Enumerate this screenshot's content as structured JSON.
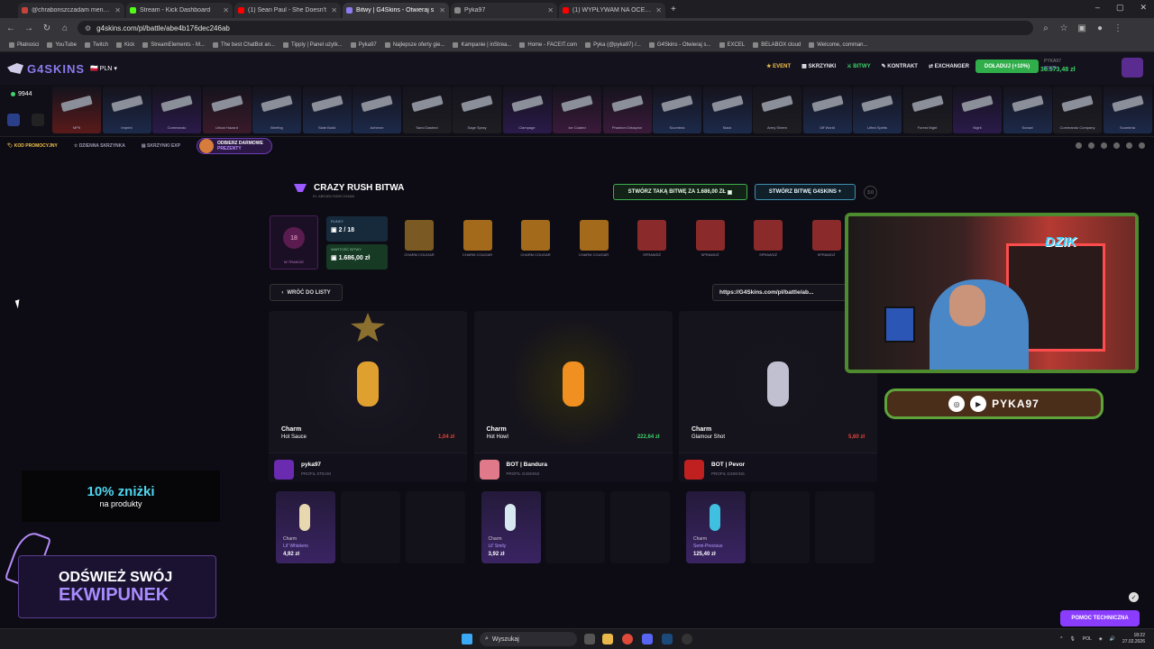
{
  "browser": {
    "tabs": [
      {
        "title": "@chrabonszczadam mention",
        "color": "#c7433a",
        "active": false
      },
      {
        "title": "Stream - Kick Dashboard",
        "color": "#53fc18",
        "active": false
      },
      {
        "title": "(1) Sean Paul - She Doesn't",
        "color": "#ff0000",
        "active": false
      },
      {
        "title": "Bitwy | G4Skins - Otwieraj s",
        "color": "#8b7cf0",
        "active": true
      },
      {
        "title": "Pyka97",
        "color": "#888888",
        "active": false
      },
      {
        "title": "(1) WYPŁYWAM NA OCEAN...",
        "color": "#ff0000",
        "active": false
      }
    ],
    "url": "g4skins.com/pl/battle/abe4b176dec246ab",
    "bookmarks": [
      "Płatności",
      "YouTube",
      "Twitch",
      "Kick",
      "StreamElements - M...",
      "The best ChatBot an...",
      "Tipply | Panel użytk...",
      "Pyka97",
      "Najlepsze oferty gie...",
      "Kampanie | inStrea...",
      "Home - FACEIT.com",
      "Pyka (@pyka97) /...",
      "G4Skins - Otwieraj s...",
      "EXCEL",
      "BELABOX cloud",
      "Welcome, comman..."
    ]
  },
  "header": {
    "logo": "G4SKINS",
    "currency": "PLN",
    "nav": [
      "EVENT",
      "SKRZYNKI",
      "BITWY",
      "KONTRAKT",
      "EXCHANGER"
    ],
    "topup": "DOŁADUJ (+10%)",
    "username": "PYKA97",
    "xp": "59125",
    "balance": "36.573,48 zł"
  },
  "strip": {
    "online": "9944",
    "drops": [
      {
        "name": "MP5",
        "color": "#5a1a1a"
      },
      {
        "name": "Imprint",
        "color": "#1c2a4a"
      },
      {
        "name": "Commando",
        "color": "#2a1a4a"
      },
      {
        "name": "Urban Hazard",
        "color": "#3a1a2a"
      },
      {
        "name": "Briefing",
        "color": "#1c2a4a"
      },
      {
        "name": "Slate Build",
        "color": "#1c2a4a"
      },
      {
        "name": "Acheron",
        "color": "#1c2a4a"
      },
      {
        "name": "Sand Dashed",
        "color": "#1e1e22"
      },
      {
        "name": "Sage Spray",
        "color": "#1e1e22"
      },
      {
        "name": "Clampage",
        "color": "#2a1a4a"
      },
      {
        "name": "Ice Coaled",
        "color": "#3a1a3a"
      },
      {
        "name": "Phantom Disruptor",
        "color": "#3a1a3a"
      },
      {
        "name": "Scumbria",
        "color": "#1c2a4a"
      },
      {
        "name": "Slack",
        "color": "#1c2a4a"
      },
      {
        "name": "Army Sheen",
        "color": "#1e1e22"
      },
      {
        "name": "Off World",
        "color": "#1c2a4a"
      },
      {
        "name": "Lifted Spirits",
        "color": "#1c2a4a"
      },
      {
        "name": "Forest Night",
        "color": "#1e1e22"
      },
      {
        "name": "Night",
        "color": "#2a1a4a"
      },
      {
        "name": "Scrawl",
        "color": "#1c2a4a"
      },
      {
        "name": "Commando Company",
        "color": "#1e1e22"
      },
      {
        "name": "Scumbria",
        "color": "#1c2a4a"
      }
    ]
  },
  "subnav": {
    "promo": "KOD PROMOCYJNY",
    "daily": "DZIENNA SKRZYNKA",
    "exp": "SKRZYNKI EXP",
    "gift_a": "ODBIERZ DARMOWE",
    "gift_b": "PREZENTY"
  },
  "battle": {
    "title": "CRAZY RUSH BITWA",
    "id": "ID: ABE4B176DEC246AB",
    "create_same": "STWÓRZ TAKĄ BITWĘ ZA 1.686,00 ZŁ",
    "create_g4": "STWÓRZ BITWĘ G4SKINS",
    "help": "3.0",
    "mode_n": "18",
    "mode_s": "W TRAKCIE",
    "rounds_label": "RUNDY",
    "rounds": "2 / 18",
    "value_label": "WARTOŚĆ BITWY",
    "value": "1.686,00 zł",
    "cases": [
      {
        "name": "CHARM COUGAR",
        "color": "#7a5a22"
      },
      {
        "name": "CHARM COUGAR",
        "color": "#a36a1c"
      },
      {
        "name": "CHARM COUGAR",
        "color": "#a36a1c"
      },
      {
        "name": "CHARM COUGAR",
        "color": "#a36a1c"
      },
      {
        "name": "SPRAWDŹ",
        "color": "#8b2a2a"
      },
      {
        "name": "SPRAWDŹ",
        "color": "#8b2a2a"
      },
      {
        "name": "SPRAWDŹ",
        "color": "#8b2a2a"
      },
      {
        "name": "SPRAWDŹ",
        "color": "#8b2a2a"
      }
    ],
    "back": "WRÓĆ DO LISTY",
    "link": "https://G4Skins.com/pl/battle/ab..."
  },
  "players": [
    {
      "type": "Charm",
      "item": "Hot Sauce",
      "price": "1,04 zł",
      "price_color": "#e0443a",
      "glow": "#1a1822",
      "item_color": "#e0a030",
      "name": "pyka97",
      "sub": "PROFIL STEAM",
      "avatar": "#6a2bb0"
    },
    {
      "type": "Charm",
      "item": "Hot Howl",
      "price": "222,64 zł",
      "price_color": "#3ed36a",
      "glow": "#2d2a10",
      "item_color": "#f09020",
      "name": "BOT | Bandura",
      "sub": "PROFIL G4SKINS",
      "avatar": "#e07a8a"
    },
    {
      "type": "Charm",
      "item": "Glamour Shot",
      "price": "5,60 zł",
      "price_color": "#e0443a",
      "glow": "#16151e",
      "item_color": "#c0c0d0",
      "name": "BOT | Pevor",
      "sub": "PROFIL G4SKINS",
      "avatar": "#c02020"
    }
  ],
  "mini_items": [
    {
      "type": "Charm",
      "name": "Lil' Whiskers",
      "price": "4,92 zł",
      "color": "#e8d8b0"
    },
    {
      "type": "Charm",
      "name": "Lil' Smily",
      "price": "3,92 zł",
      "color": "#d8e8f0"
    },
    {
      "type": "Charm",
      "name": "Semi-Precious",
      "price": "125,40 zł",
      "color": "#40c0e0"
    }
  ],
  "overlays": {
    "promo_a": "10% zniżki",
    "promo_b": "na produkty",
    "refresh_a": "ODŚWIEŻ SWÓJ",
    "refresh_b": "EKWIPUNEK",
    "handle": "PYKA97",
    "dzik": "DZIK",
    "support": "POMOC TECHNICZNA"
  },
  "taskbar": {
    "search": "Wyszukaj",
    "lang": "POL",
    "time": "18:22",
    "date": "27.02.2026"
  }
}
